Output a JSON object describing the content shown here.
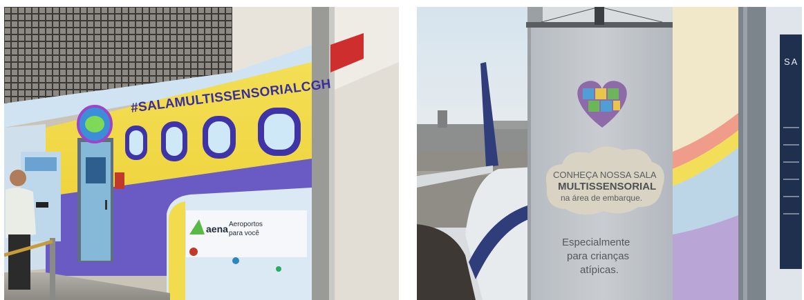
{
  "left_photo": {
    "hashtag": "#SALAMULTISSENSORIALCGH",
    "logo_word": "aena",
    "logo_tagline_line1": "Aeroportos",
    "logo_tagline_line2": "para você"
  },
  "right_photo": {
    "banner_line1": "CONHEÇA NOSSA SALA",
    "banner_line2": "MULTISSENSORIAL",
    "banner_line3": "na área de embarque.",
    "banner_line4": "Especialmente",
    "banner_line5": "para crianças",
    "banner_line6": "atípicas.",
    "window_sign_fragment": "SA"
  },
  "colors": {
    "yellow": "#f2dc4e",
    "purple": "#6a5bc4",
    "window_frame": "#4b3db4",
    "banner": "#c3c7cc"
  }
}
